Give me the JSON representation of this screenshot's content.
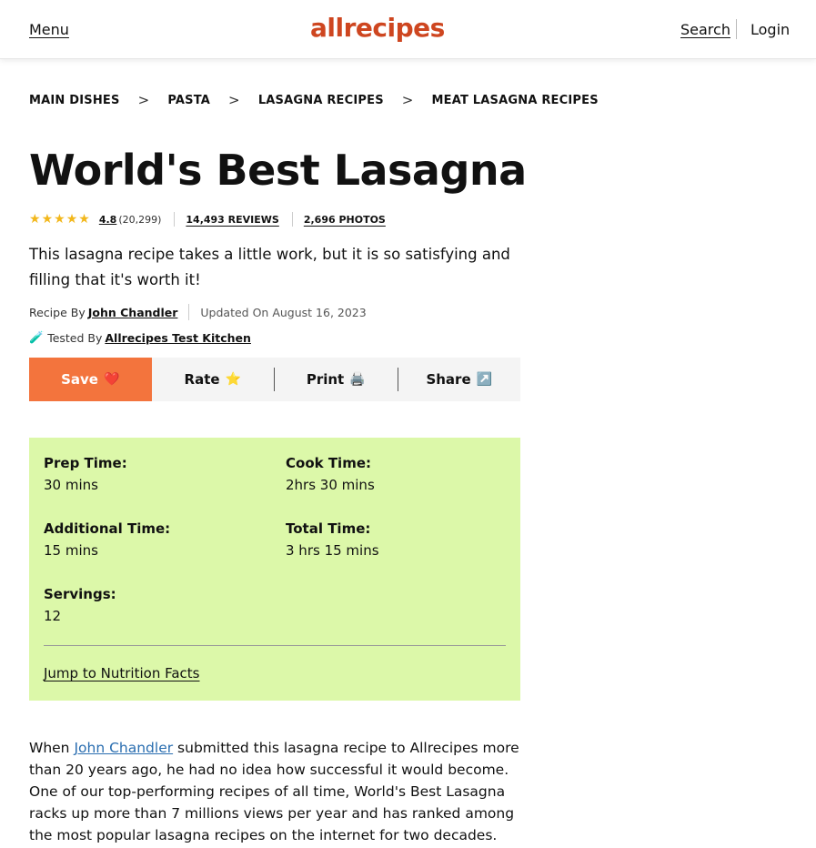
{
  "header": {
    "menu": "Menu",
    "logo": "allrecipes",
    "search": "Search",
    "login": "Login"
  },
  "breadcrumb": [
    "MAIN DISHES",
    "PASTA",
    "LASAGNA RECIPES",
    "MEAT LASAGNA RECIPES"
  ],
  "breadcrumb_sep": ">",
  "recipe": {
    "title": "World's Best Lasagna",
    "rating": "4.8",
    "rating_count": "(20,299)",
    "stars": 5,
    "reviews": "14,493 REVIEWS",
    "photos": "2,696 PHOTOS",
    "description": "This lasagna recipe takes a little work, but it is so satisfying and filling that it's worth it!",
    "recipe_by_label": "Recipe By",
    "author": "John Chandler",
    "updated": "Updated On August 16, 2023",
    "tested_label": "Tested By",
    "tested_by": "Allrecipes Test Kitchen"
  },
  "actions": {
    "save": "Save",
    "rate": "Rate",
    "print": "Print",
    "share": "Share"
  },
  "icons": {
    "star": "star-icon",
    "heart": "heart-icon",
    "printer": "printer-icon",
    "share": "share-arrow-icon",
    "test_tube": "test-tube-icon"
  },
  "details": {
    "prep_label": "Prep Time:",
    "prep_val": "30 mins",
    "cook_label": "Cook Time:",
    "cook_val": "2hrs 30 mins",
    "additional_label": "Additional Time:",
    "additional_val": "15 mins",
    "total_label": "Total Time:",
    "total_val": "3 hrs 15 mins",
    "servings_label": "Servings:",
    "servings_val": "12",
    "jump": "Jump to Nutrition Facts"
  },
  "body": {
    "when": "When",
    "author_link": "John Chandler",
    "rest": "submitted this lasagna recipe to Allrecipes more than 20 years ago, he had no idea how successful it would become. One of our top-performing recipes of all time, World's Best Lasagna racks up more than 7 millions views per year and has ranked among the most popular lasagna recipes on the internet for two decades. Unfortunately, John unexpectedly"
  },
  "colors": {
    "brand": "#ce4620",
    "save_button": "#f3743d",
    "details_bg": "#dcf8a9",
    "star": "#f2b71b",
    "link": "#2a6eb0"
  }
}
